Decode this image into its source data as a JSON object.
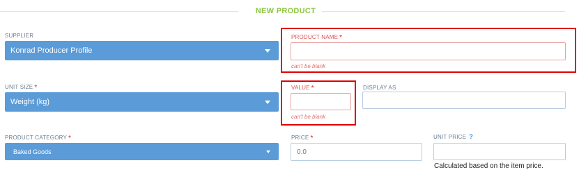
{
  "section": {
    "title": "NEW PRODUCT"
  },
  "supplier": {
    "label": "SUPPLIER",
    "value": "Konrad Producer Profile"
  },
  "product_name": {
    "label": "PRODUCT NAME",
    "required_mark": "*",
    "value": "",
    "error": "can't be blank"
  },
  "unit_size": {
    "label": "UNIT SIZE",
    "required_mark": "*",
    "value": "Weight (kg)"
  },
  "value_field": {
    "label": "VALUE",
    "required_mark": "*",
    "value": "",
    "error": "can't be blank"
  },
  "display_as": {
    "label": "DISPLAY AS",
    "value": ""
  },
  "product_category": {
    "label": "PRODUCT CATEGORY",
    "required_mark": "*",
    "value": "Baked Goods"
  },
  "price": {
    "label": "PRICE",
    "required_mark": "*",
    "placeholder": "0.0"
  },
  "unit_price": {
    "label": "UNIT PRICE",
    "help_icon": "question-icon",
    "help_glyph": "?",
    "value": "",
    "hint": "Calculated based on the item price."
  },
  "colors": {
    "accent": "#8cc63f",
    "select_bg": "#5b9bd8",
    "error": "#e00000",
    "required": "#e02020"
  }
}
